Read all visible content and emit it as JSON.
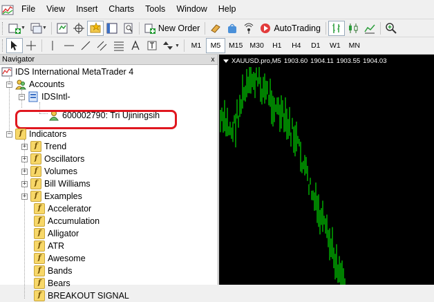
{
  "menu": [
    "File",
    "View",
    "Insert",
    "Charts",
    "Tools",
    "Window",
    "Help"
  ],
  "toolbar": {
    "new_order": "New Order",
    "autotrading": "AutoTrading"
  },
  "timeframes": [
    "M1",
    "M5",
    "M15",
    "M30",
    "H1",
    "H4",
    "D1",
    "W1",
    "MN"
  ],
  "active_timeframe": "M5",
  "navigator": {
    "title": "Navigator",
    "close": "x",
    "root": "IDS International MetaTrader 4",
    "accounts": "Accounts",
    "server": "IDSIntl-",
    "account": "600002790: Tri Ujiningsih",
    "indicators": "Indicators",
    "folders": [
      "Trend",
      "Oscillators",
      "Volumes",
      "Bill Williams",
      "Examples"
    ],
    "items": [
      "Accelerator",
      "Accumulation",
      "Alligator",
      "ATR",
      "Awesome",
      "Bands",
      "Bears",
      "BREAKOUT SIGNAL"
    ]
  },
  "chart": {
    "symbol": "XAUUSD.pro,M5",
    "open": "1903.60",
    "high": "1904.11",
    "low": "1903.55",
    "close": "1904.03",
    "bar_color": "#00ff00",
    "background": "#000000"
  },
  "colors": {
    "highlight_border": "#e0171f"
  }
}
